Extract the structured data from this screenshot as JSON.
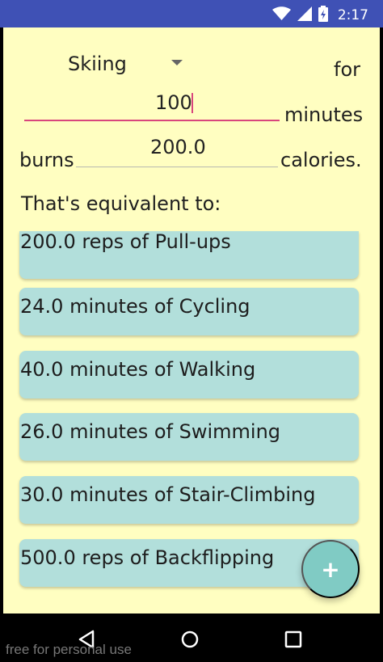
{
  "status_bar": {
    "time": "2:17"
  },
  "form": {
    "activity": "Skiing",
    "for_label": "for",
    "minutes_value": "100",
    "minutes_label": "minutes",
    "burns_label": "burns",
    "calories_value": "200.0",
    "calories_label": "calories."
  },
  "equivalents_title": "That's equivalent to:",
  "equivalents": [
    "200.0 reps of Pull-ups",
    "24.0 minutes of Cycling",
    "40.0 minutes of Walking",
    "26.0 minutes of Swimming",
    "30.0 minutes of Stair-Climbing",
    "500.0 reps of Backflipping"
  ],
  "fab": {
    "label": "+"
  },
  "watermark": "free for personal use",
  "colors": {
    "status_bar": "#3f51b5",
    "background": "#fffec1",
    "card": "#b2dfdb",
    "accent": "#d9467d",
    "fab": "#80cbc4"
  },
  "icons": {
    "wifi": "wifi-icon",
    "signal": "signal-icon",
    "battery": "battery-icon",
    "dropdown": "chevron-down-icon",
    "add": "add-icon",
    "back": "back-icon",
    "home": "home-icon",
    "recent": "recent-apps-icon"
  }
}
